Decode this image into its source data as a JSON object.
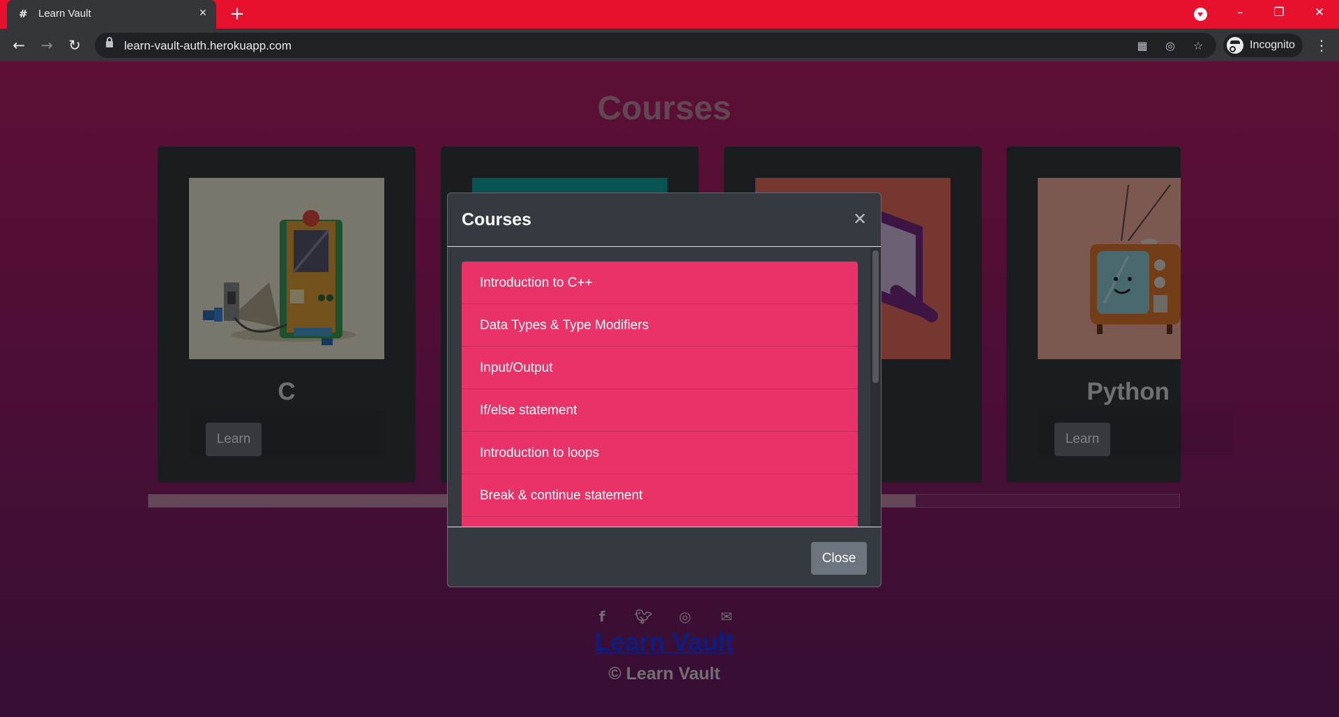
{
  "browser": {
    "tab_title": "Learn Vault",
    "tab_favicon": "#",
    "url": "learn-vault-auth.herokuapp.com",
    "profile_label": "Incognito",
    "colors": {
      "tabbar": "#e8112d",
      "toolbar": "#35363a",
      "omnibox": "#202124"
    }
  },
  "page": {
    "title": "Courses",
    "cards": [
      {
        "title": "C",
        "learn_label": "Learn",
        "image": "arcade-machine-illustration"
      },
      {
        "title": "",
        "learn_label": "",
        "image": "teal-illustration"
      },
      {
        "title": "",
        "learn_label": "",
        "image": "magnifier-illustration"
      },
      {
        "title": "Python",
        "learn_label": "Learn",
        "image": "retro-tv-illustration"
      }
    ],
    "footer": {
      "social_icons": [
        "facebook-icon",
        "twitter-icon",
        "instagram-icon",
        "envelope-icon"
      ],
      "brand_link": "Learn Vault",
      "copyright": "© Learn Vault"
    },
    "colors": {
      "gradient_top": "#bb1e6a",
      "gradient_bottom": "#6c1c68",
      "card_bg": "#343a40"
    }
  },
  "modal": {
    "title": "Courses",
    "lessons": [
      "Introduction to C++",
      "Data Types & Type Modifiers",
      "Input/Output",
      "If/else statement",
      "Introduction to loops",
      "Break & continue statement"
    ],
    "close_label": "Close",
    "colors": {
      "lesson_bg": "#e83268",
      "modal_bg": "#343a40"
    }
  }
}
